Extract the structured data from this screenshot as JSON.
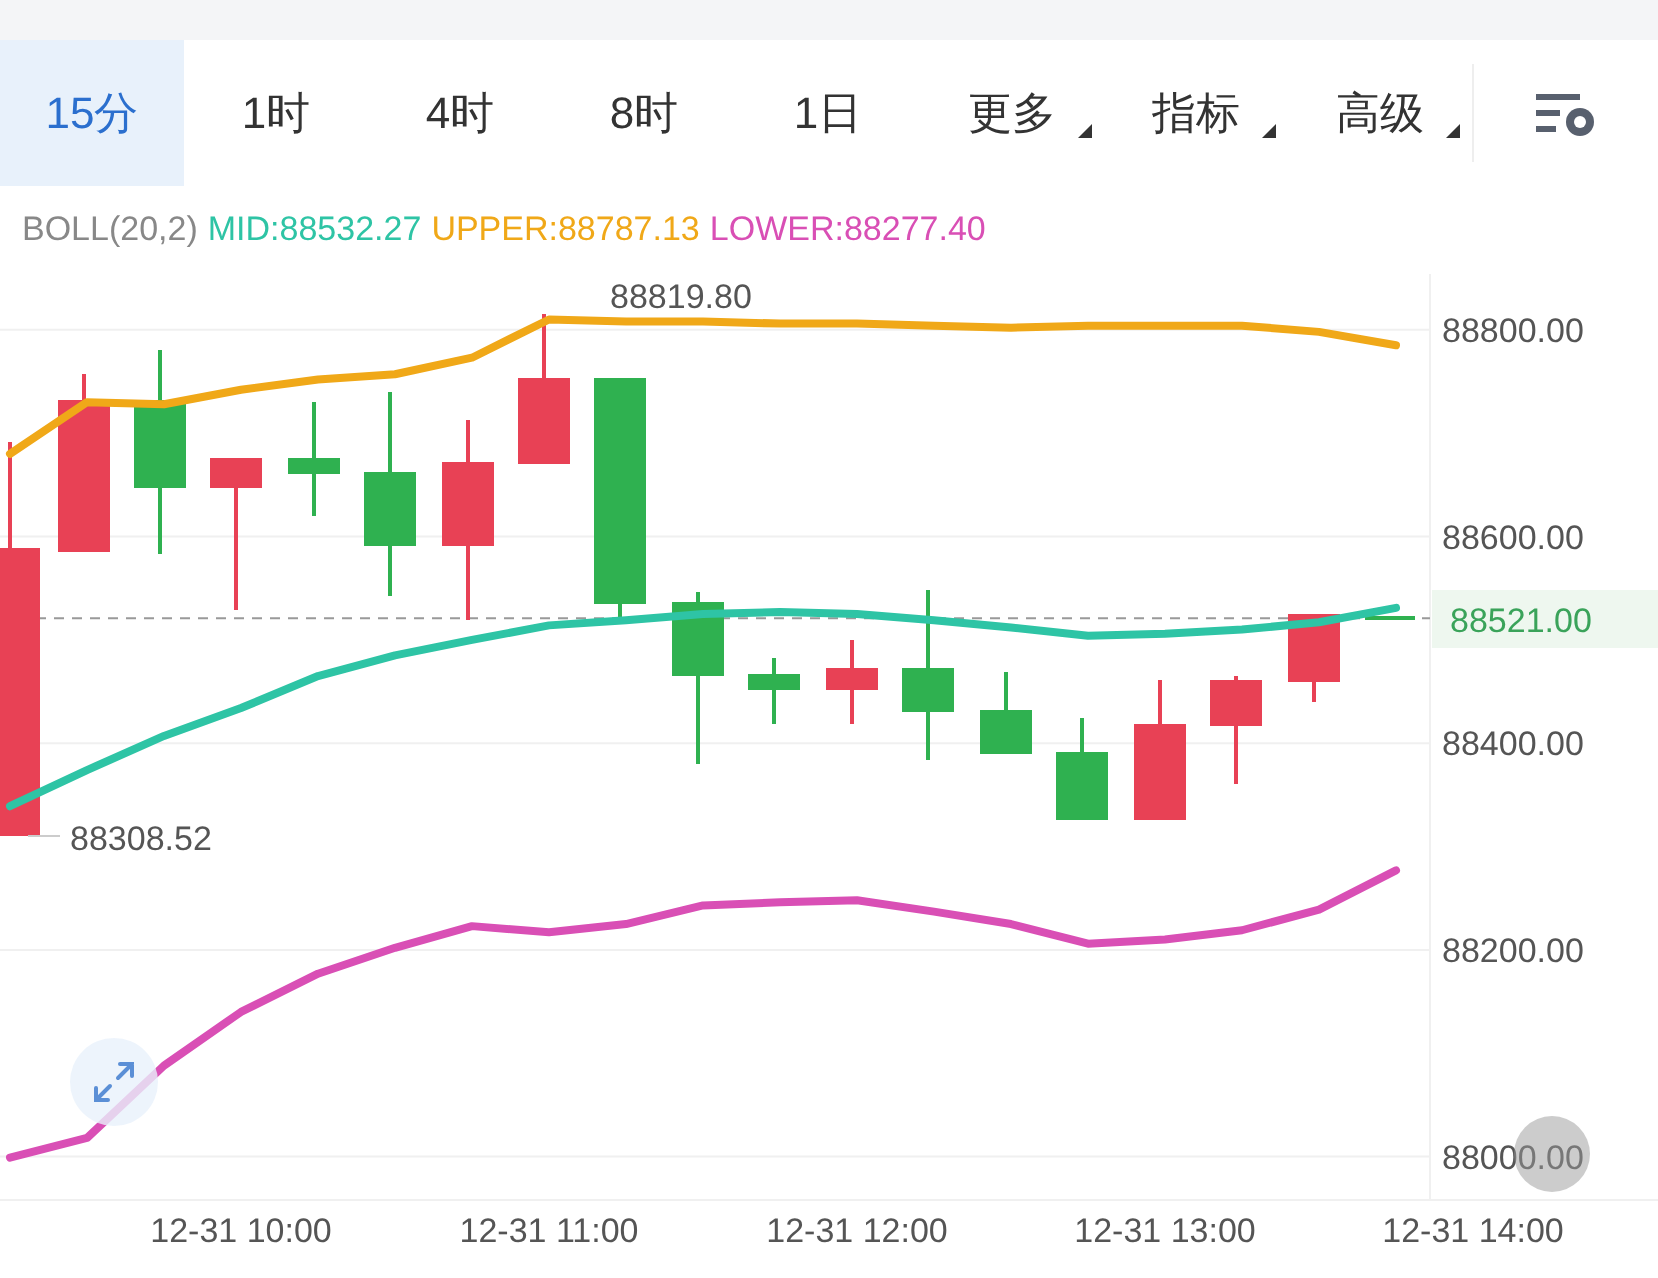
{
  "tabs": [
    {
      "label": "15分",
      "selected": true,
      "dropdown": false
    },
    {
      "label": "1时",
      "selected": false,
      "dropdown": false
    },
    {
      "label": "4时",
      "selected": false,
      "dropdown": false
    },
    {
      "label": "8时",
      "selected": false,
      "dropdown": false
    },
    {
      "label": "1日",
      "selected": false,
      "dropdown": false
    },
    {
      "label": "更多",
      "selected": false,
      "dropdown": true
    },
    {
      "label": "指标",
      "selected": false,
      "dropdown": true
    },
    {
      "label": "高级",
      "selected": false,
      "dropdown": true
    }
  ],
  "indicator": {
    "name": "BOLL(20,2)",
    "readings": [
      {
        "label": "MID:88532.27",
        "color": "#2ec4a5"
      },
      {
        "label": "UPPER:88787.13",
        "color": "#f0a818"
      },
      {
        "label": "LOWER:88277.40",
        "color": "#d94fb5"
      }
    ]
  },
  "chart": {
    "high_label": "88819.80",
    "low_label": "88308.52",
    "last_price": "88521.00",
    "chart_data": {
      "type": "line",
      "categories": [
        null,
        null,
        null,
        "12-31 10:00",
        null,
        null,
        null,
        "12-31 11:00",
        null,
        null,
        null,
        "12-31 12:00",
        null,
        null,
        null,
        "12-31 13:00",
        null,
        null,
        null,
        "12-31 14:00"
      ],
      "series": [
        {
          "color": "#f0a818",
          "values": [
            88680,
            88730,
            88728,
            88742,
            88752,
            88757,
            88773,
            88810,
            88808,
            88808,
            88806,
            88806,
            88804,
            88802,
            88804,
            88804,
            88804,
            88798,
            88785,
            null
          ]
        },
        {
          "color": "#2ec4a5",
          "values": [
            88339,
            88374,
            88407,
            88434,
            88465,
            88485,
            88500,
            88514,
            88519,
            88525,
            88527,
            88525,
            88519,
            88512,
            88504,
            88506,
            88510,
            88517,
            88531,
            null
          ]
        },
        {
          "color": "#d94fb5",
          "values": [
            87999,
            88018,
            88088,
            88140,
            88177,
            88202,
            88223,
            88217,
            88225,
            88243,
            88246,
            88248,
            88237,
            88225,
            88206,
            88210,
            88219,
            88239,
            88277,
            null
          ]
        }
      ],
      "ylim": [
        87958,
        88854
      ],
      "grid": true,
      "ref_lines": [
        {
          "axis": "y",
          "value": 88521
        }
      ],
      "yticks": [
        {
          "value": 88800,
          "label": "88800.00"
        },
        {
          "value": 88600,
          "label": "88600.00"
        },
        {
          "value": 88400,
          "label": "88400.00"
        },
        {
          "value": 88200,
          "label": "88200.00"
        },
        {
          "value": 88000,
          "label": "88000.00"
        }
      ]
    }
  }
}
